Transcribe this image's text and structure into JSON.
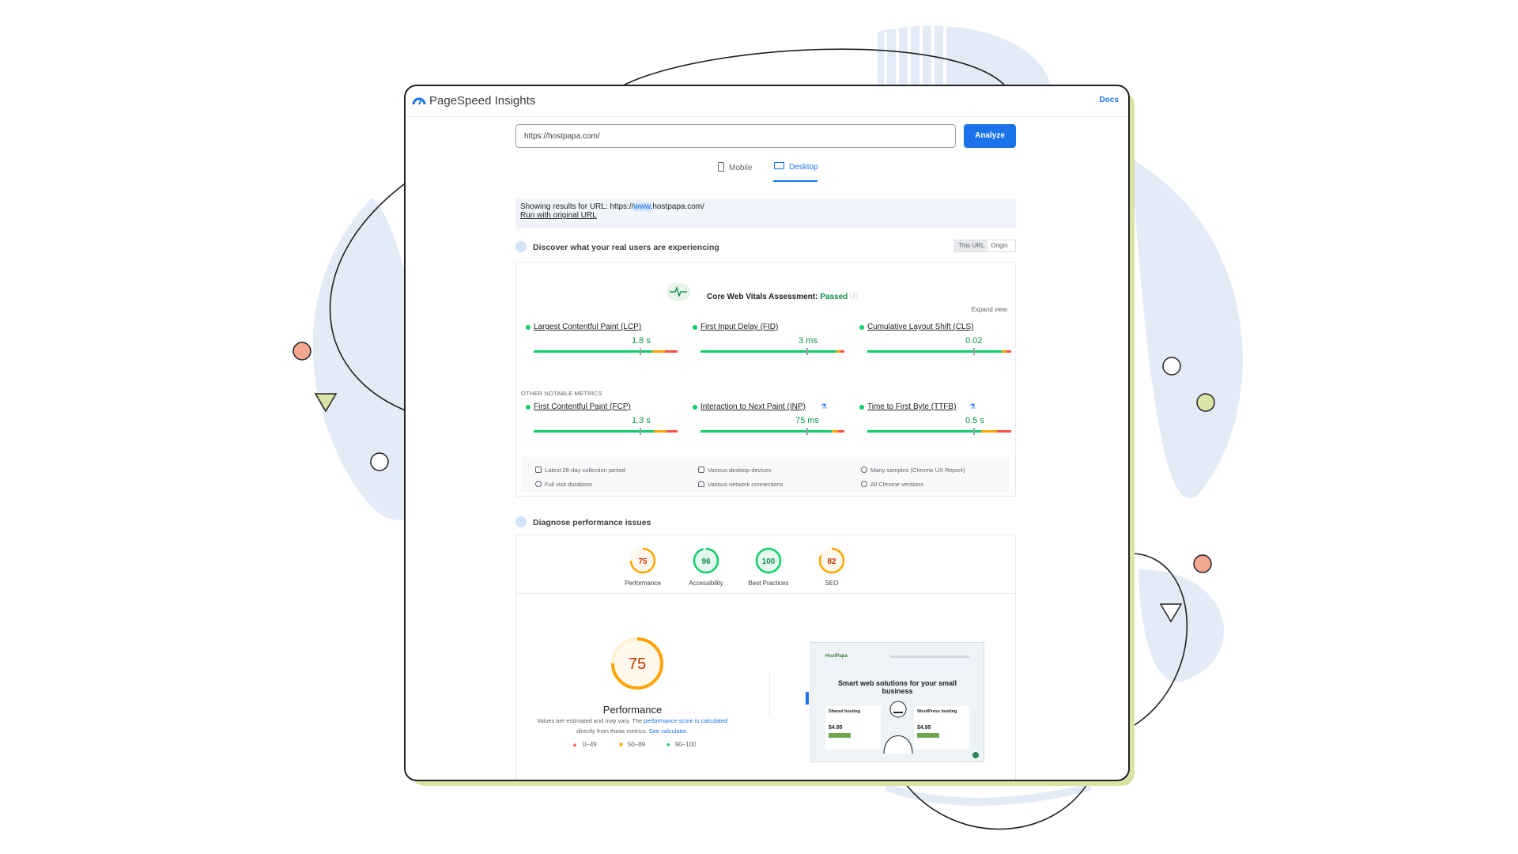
{
  "app": {
    "title": "PageSpeed Insights",
    "docs_label": "Docs"
  },
  "search": {
    "url_value": "https://hostpapa.com/",
    "analyze_label": "Analyze"
  },
  "tabs": [
    {
      "label": "Mobile",
      "active": false,
      "icon": "phone-icon"
    },
    {
      "label": "Desktop",
      "active": true,
      "icon": "monitor-icon"
    }
  ],
  "notice": {
    "prefix": "Showing results for URL: https://",
    "highlight": "www.",
    "suffix": "hostpapa.com/",
    "rerun_link": "Run with original URL"
  },
  "field_data": {
    "section_title": "Discover what your real users are experiencing",
    "toggle": [
      "This URL",
      "Origin"
    ],
    "cwv_label": "Core Web Vitals Assessment:",
    "cwv_status": "Passed",
    "expand_label": "Expand view",
    "core_metrics": [
      {
        "name": "Largest Contentful Paint (LCP)",
        "value": "1.8 s",
        "marker_fraction": 0.74
      },
      {
        "name": "First Input Delay (FID)",
        "value": "3 ms",
        "marker_fraction": 0.74
      },
      {
        "name": "Cumulative Layout Shift (CLS)",
        "value": "0.02",
        "marker_fraction": 0.74
      }
    ],
    "other_heading": "OTHER NOTABLE METRICS",
    "other_metrics": [
      {
        "name": "First Contentful Paint (FCP)",
        "value": "1.3 s",
        "marker_fraction": 0.74
      },
      {
        "name": "Interaction to Next Paint (INP)",
        "value": "75 ms",
        "marker_fraction": 0.74
      },
      {
        "name": "Time to First Byte (TTFB)",
        "value": "0.5 s",
        "marker_fraction": 0.74
      }
    ],
    "footer": [
      {
        "icon": "calendar-icon",
        "text": "Latest 28-day collection period"
      },
      {
        "icon": "devices-icon",
        "text": "Various desktop devices"
      },
      {
        "icon": "people-icon",
        "text": "Many samples (Chrome UX Report)"
      },
      {
        "icon": "clock-icon",
        "text": "Full visit durations"
      },
      {
        "icon": "wifi-icon",
        "text": "Various network connections"
      },
      {
        "icon": "chrome-icon",
        "text": "All Chrome versions"
      }
    ]
  },
  "lab": {
    "section_title": "Diagnose performance issues",
    "scores": [
      {
        "label": "Performance",
        "score": "75",
        "color": "#ffa400"
      },
      {
        "label": "Accessibility",
        "score": "96",
        "color": "#0cce6b"
      },
      {
        "label": "Best Practices",
        "score": "100",
        "color": "#0cce6b"
      },
      {
        "label": "SEO",
        "score": "82",
        "color": "#ffa400"
      }
    ],
    "main_score": "75",
    "main_label": "Performance",
    "note_part1": "Values are estimated and may vary. The ",
    "note_link1": "performance score is calculated",
    "note_part2": " directly from these metrics. ",
    "note_link2": "See calculator.",
    "legend": [
      {
        "range": "0–49",
        "color": "#ff4e42",
        "shape": "triangle"
      },
      {
        "range": "50–89",
        "color": "#ffa400",
        "shape": "square"
      },
      {
        "range": "90–100",
        "color": "#0cce6b",
        "shape": "circle"
      }
    ],
    "screenshot": {
      "brand": "HostPapa",
      "headline": "Smart web solutions for your small business",
      "card1_title": "Shared hosting",
      "card1_price": "$4.95",
      "card2_title": "WordPress hosting",
      "card2_price": "$4.95"
    }
  },
  "colors": {
    "accent": "#1a73e8",
    "good": "#0cce6b",
    "average": "#ffa400",
    "poor": "#ff4e42"
  }
}
